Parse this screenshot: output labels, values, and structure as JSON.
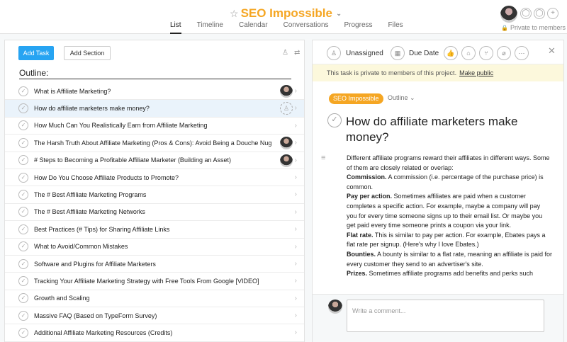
{
  "header": {
    "project_title": "SEO Impossible",
    "tabs": [
      "List",
      "Timeline",
      "Calendar",
      "Conversations",
      "Progress",
      "Files"
    ],
    "active_tab": "List",
    "private_label": "Private to members"
  },
  "list_pane": {
    "add_task_label": "Add Task",
    "add_section_label": "Add Section",
    "section_title": "Outline:",
    "tasks": [
      {
        "name": "What is Affiliate Marketing?",
        "assignee": "avatar"
      },
      {
        "name": "How do affiliate marketers make money?",
        "assignee": "unassigned",
        "selected": true
      },
      {
        "name": "How Much Can You Realistically Earn from Affiliate Marketing",
        "assignee": ""
      },
      {
        "name": "The Harsh Truth About Affiliate Marketing (Pros & Cons): Avoid Being a Douche Nug",
        "assignee": "avatar"
      },
      {
        "name": "# Steps to Becoming a Profitable Affiliate Marketer (Building an Asset)",
        "assignee": "avatar"
      },
      {
        "name": "How Do You Choose Affiliate Products to Promote?",
        "assignee": ""
      },
      {
        "name": "The # Best Affiliate Marketing Programs",
        "assignee": ""
      },
      {
        "name": "The # Best Affiliate Marketing Networks",
        "assignee": ""
      },
      {
        "name": "Best Practices (# Tips) for Sharing Affiliate Links",
        "assignee": ""
      },
      {
        "name": "What to Avoid/Common Mistakes",
        "assignee": ""
      },
      {
        "name": "Software and Plugins for Affiliate Marketers",
        "assignee": ""
      },
      {
        "name": "Tracking Your Affiliate Marketing Strategy with Free Tools From Google [VIDEO]",
        "assignee": ""
      },
      {
        "name": "Growth and Scaling",
        "assignee": ""
      },
      {
        "name": "Massive FAQ (Based on TypeForm Survey)",
        "assignee": ""
      },
      {
        "name": "Additional Affiliate Marketing Resources (Credits)",
        "assignee": ""
      }
    ]
  },
  "detail_pane": {
    "assignee_label": "Unassigned",
    "due_date_label": "Due Date",
    "private_notice": "This task is private to members of this project.",
    "make_public_label": "Make public",
    "project_badge": "SEO Impossible",
    "section_label": "Outline",
    "task_title": "How do affiliate marketers make money?",
    "description": [
      {
        "bold": "",
        "text": "Different affiliate programs reward their affiliates in different ways. Some of them are closely related or overlap:"
      },
      {
        "bold": "Commission.",
        "text": " A commission (i.e. percentage of the purchase price) is common."
      },
      {
        "bold": "Pay per action.",
        "text": " Sometimes affiliates are paid when a customer completes a specific action. For example, maybe a company will pay you for every time someone signs up to their email list. Or maybe you get paid every time someone prints a coupon via your link."
      },
      {
        "bold": "Flat rate.",
        "text": " This is similar to pay per action. For example, Ebates pays a flat rate per signup. (Here's why I love Ebates.)"
      },
      {
        "bold": "Bounties.",
        "text": " A bounty is similar to a flat rate, meaning an affiliate is paid for every customer they send to an advertiser's site."
      },
      {
        "bold": "Prizes.",
        "text": " Sometimes affiliate programs add benefits and perks such"
      }
    ],
    "comment_placeholder": "Write a comment..."
  }
}
